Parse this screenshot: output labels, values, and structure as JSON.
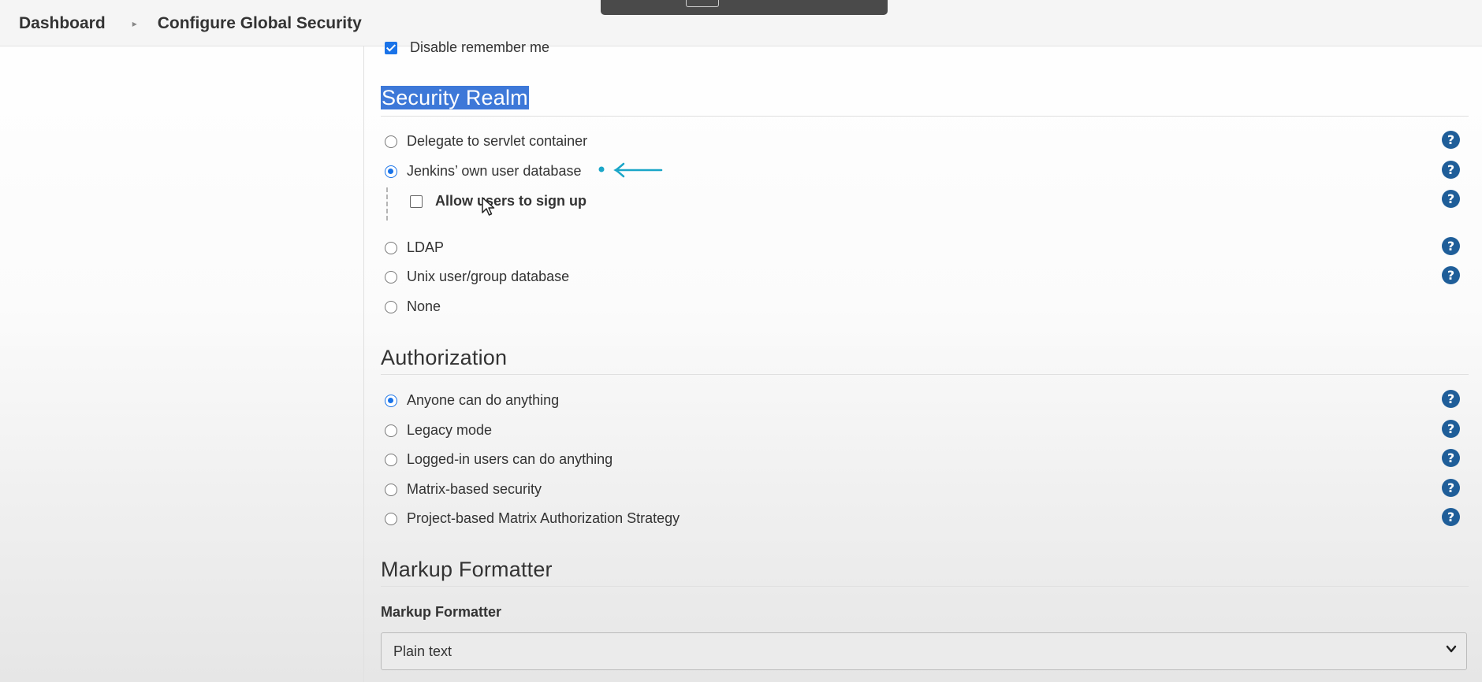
{
  "breadcrumb": {
    "items": [
      "Dashboard",
      "Configure Global Security"
    ],
    "separator": "▸"
  },
  "top_option": {
    "label": "Disable remember me",
    "checked": true
  },
  "security_realm": {
    "title": "Security Realm",
    "options": [
      {
        "label": "Delegate to servlet container",
        "selected": false
      },
      {
        "label": "Jenkins’ own user database",
        "selected": true
      },
      {
        "label": "LDAP",
        "selected": false
      },
      {
        "label": "Unix user/group database",
        "selected": false
      },
      {
        "label": "None",
        "selected": false
      }
    ],
    "sub_option": {
      "label": "Allow users to sign up",
      "checked": false
    }
  },
  "authorization": {
    "title": "Authorization",
    "options": [
      {
        "label": "Anyone can do anything",
        "selected": true
      },
      {
        "label": "Legacy mode",
        "selected": false
      },
      {
        "label": "Logged-in users can do anything",
        "selected": false
      },
      {
        "label": "Matrix-based security",
        "selected": false
      },
      {
        "label": "Project-based Matrix Authorization Strategy",
        "selected": false
      }
    ]
  },
  "markup_formatter": {
    "title": "Markup Formatter",
    "field_label": "Markup Formatter",
    "selected_value": "Plain text"
  },
  "icons": {
    "help": "?",
    "chevron": "⌄"
  },
  "colors": {
    "accent": "#1a73e8",
    "help_icon": "#1f5e99",
    "highlight": "#3d78d8",
    "annotation": "#1aa6c8"
  }
}
